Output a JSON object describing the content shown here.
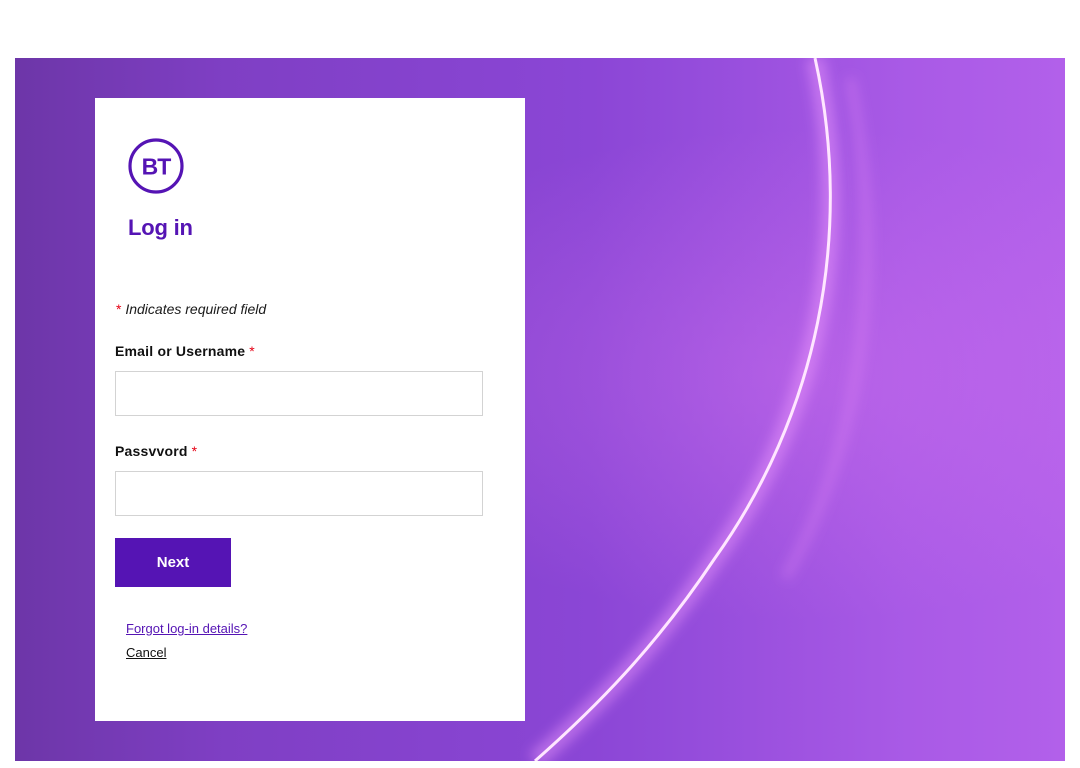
{
  "brand": {
    "logo_text": "BT",
    "primary_color": "#5514b4",
    "required_color": "#e60014"
  },
  "login": {
    "title": "Log in",
    "required_marker": "*",
    "required_note": "Indicates required field",
    "username_label": "Email or Username",
    "username_value": "",
    "password_label": "Passvvord",
    "password_value": "",
    "next_label": "Next",
    "forgot_link": "Forgot log-in details?",
    "cancel_link": "Cancel"
  }
}
